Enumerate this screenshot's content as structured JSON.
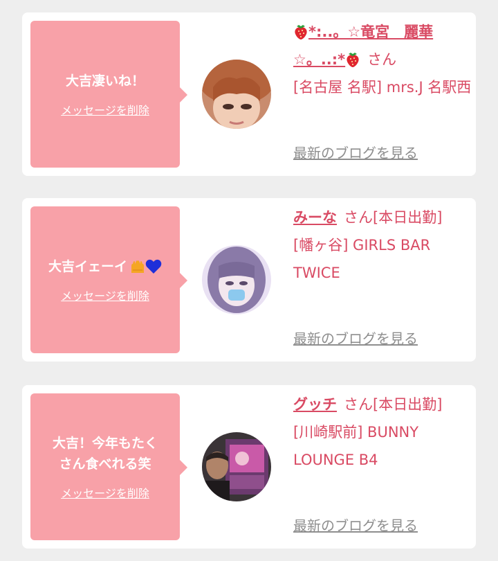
{
  "messages": [
    {
      "greeting": "大吉凄いね！",
      "delete_label": "メッセージを削除",
      "name_prefix": "*:..。☆竜宮　麗華",
      "name_suffix": "☆。..:*",
      "san": "さん",
      "shop": "[名古屋 名駅] mrs.J 名駅西",
      "blog_label": "最新のブログを見る"
    },
    {
      "greeting": "大吉イェーイ",
      "delete_label": "メッセージを削除",
      "name": "みーな",
      "san": "さん[本日出勤]",
      "shop": "[幡ヶ谷] GIRLS BAR TWICE",
      "blog_label": "最新のブログを見る"
    },
    {
      "greeting": "大吉！今年もたくさん食べれる笑",
      "delete_label": "メッセージを削除",
      "name": "グッチ",
      "san": "さん[本日出勤]",
      "shop": "[川崎駅前] BUNNY LOUNGE B4",
      "blog_label": "最新のブログを見る"
    }
  ],
  "colors": {
    "accent": "#d94a63",
    "bubble": "#f8a1a8",
    "link_gray": "#8e8e8e",
    "background": "#eeeeee"
  },
  "icons": {
    "strawberry": "strawberry-icon",
    "hands": "raised-hands-icon",
    "heart": "blue-heart-icon"
  }
}
